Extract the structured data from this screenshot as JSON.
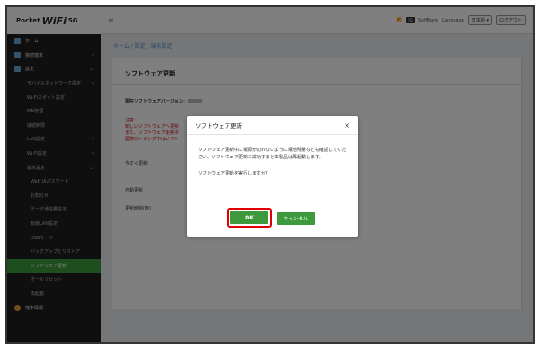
{
  "app": {
    "logo_pre": "Pocket",
    "logo_main": "WiFi",
    "logo_suf": "5G"
  },
  "sidebar": {
    "items": [
      {
        "label": "ホーム",
        "level": "top"
      },
      {
        "label": "接続端末",
        "level": "top",
        "arrow": "‹"
      },
      {
        "label": "設定",
        "level": "top",
        "arrow": "⌄"
      },
      {
        "label": "モバイルネットワーク設定",
        "level": "sub",
        "arrow": "‹"
      },
      {
        "label": "Wi-Fiスポット設定",
        "level": "sub"
      },
      {
        "label": "PIN管理",
        "level": "sub"
      },
      {
        "label": "接続制限",
        "level": "sub"
      },
      {
        "label": "LAN設定",
        "level": "sub",
        "arrow": "‹"
      },
      {
        "label": "Wi-Fi設定",
        "level": "sub",
        "arrow": "‹"
      },
      {
        "label": "端末設定",
        "level": "sub",
        "arrow": "⌄"
      },
      {
        "label": "Web UIパスワード",
        "level": "sub2"
      },
      {
        "label": "お知らせ",
        "level": "sub2"
      },
      {
        "label": "データ通信量設定",
        "level": "sub2"
      },
      {
        "label": "有線LAN設定",
        "level": "sub2"
      },
      {
        "label": "USBモード",
        "level": "sub2"
      },
      {
        "label": "バックアップとリストア",
        "level": "sub2"
      },
      {
        "label": "ソフトウェア更新",
        "level": "sub2",
        "active": true
      },
      {
        "label": "オールリセット",
        "level": "sub2"
      },
      {
        "label": "再起動",
        "level": "sub2"
      },
      {
        "label": "端末情報",
        "level": "top"
      }
    ]
  },
  "topbar": {
    "carrier": "SoftBank",
    "language_label": "Language",
    "language_value": "日本語",
    "logout": "ログアウト",
    "badge": "5G"
  },
  "breadcrumb": "ホーム / 設定 / 端末設定",
  "card": {
    "title": "ソフトウェア更新",
    "current_version_label": "現在ソフトウェアバージョン:",
    "note_title": "注意:",
    "note_lines": [
      "新しいソフトウェアへ更新",
      "また、ソフトウェア更新中",
      "国際ローミング中はソフト"
    ],
    "update_now": "今すぐ更新",
    "auto_update": "自動更新",
    "update_time": "更新時刻(時)"
  },
  "modal": {
    "title": "ソフトウェア更新",
    "close": "×",
    "body1": "ソフトウェア更新中に電源が切れないように電池残量なども確認してください。ソフトウェア更新に成功すると本製品は再起動します。",
    "body2": "ソフトウェア更新を実行しますか？",
    "ok": "OK",
    "cancel": "キャンセル"
  },
  "colors": {
    "accent": "#3c9a3c",
    "highlight": "#e00000",
    "sidebar_bg": "#1f1f1f"
  }
}
